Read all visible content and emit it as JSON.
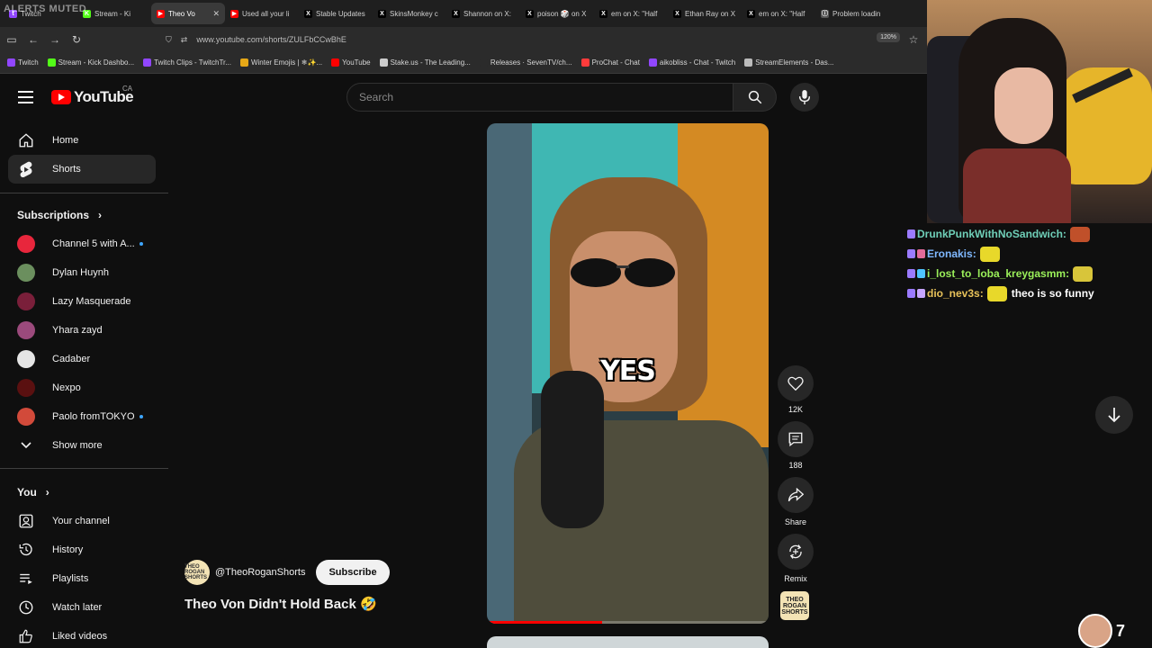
{
  "overlay": {
    "muted_text": "ALERTS MUTED"
  },
  "tabs": [
    {
      "label": "Twitch",
      "color": "#9146ff",
      "glyph": "t"
    },
    {
      "label": "Stream - Ki",
      "color": "#53fc18",
      "glyph": "K"
    },
    {
      "label": "Theo Vo",
      "color": "#ff0000",
      "glyph": "▶"
    },
    {
      "label": "Used all your li",
      "color": "#ff0000",
      "glyph": "▶"
    },
    {
      "label": "Stable Updates",
      "color": "#000000",
      "glyph": "X"
    },
    {
      "label": "SkinsMonkey c",
      "color": "#000000",
      "glyph": "X"
    },
    {
      "label": "Shannon on X:",
      "color": "#000000",
      "glyph": "X"
    },
    {
      "label": "poison 🎲 on X",
      "color": "#000000",
      "glyph": "X"
    },
    {
      "label": "em on X: \"Half",
      "color": "#000000",
      "glyph": "X"
    },
    {
      "label": "Ethan Ray on X",
      "color": "#000000",
      "glyph": "X"
    },
    {
      "label": "em on X: \"Half",
      "color": "#000000",
      "glyph": "X"
    },
    {
      "label": "Problem loadin",
      "color": "#555555",
      "glyph": "ⓘ"
    }
  ],
  "address": {
    "url": "www.youtube.com/shorts/ZULFbCCwBhE",
    "zoom": "120%"
  },
  "bookmarks": [
    {
      "label": "Twitch",
      "color": "#9146ff"
    },
    {
      "label": "Stream - Kick Dashbo...",
      "color": "#53fc18"
    },
    {
      "label": "Twitch Clips - TwitchTr...",
      "color": "#9146ff"
    },
    {
      "label": "Winter Emojis | ❄✨...",
      "color": "#e6a817"
    },
    {
      "label": "YouTube",
      "color": "#ff0000"
    },
    {
      "label": "Stake.us - The Leading...",
      "color": "#cccccc"
    },
    {
      "label": "Releases · SevenTV/ch...",
      "color": "#2b2b2b"
    },
    {
      "label": "ProChat - Chat",
      "color": "#ff3b3b"
    },
    {
      "label": "aikobliss - Chat - Twitch",
      "color": "#9146ff"
    },
    {
      "label": "StreamElements - Das...",
      "color": "#bbbbbb"
    }
  ],
  "header": {
    "logo_text": "YouTube",
    "country": "CA",
    "search_placeholder": "Search"
  },
  "sidebar": {
    "home": "Home",
    "shorts": "Shorts",
    "subscriptions_heading": "Subscriptions",
    "subscriptions": [
      {
        "label": "Channel 5 with A...",
        "color": "#e8263c",
        "new": true
      },
      {
        "label": "Dylan Huynh",
        "color": "#6b8f5e",
        "new": false
      },
      {
        "label": "Lazy Masquerade",
        "color": "#7a1f3a",
        "new": false
      },
      {
        "label": "Yhara zayd",
        "color": "#9b4a7c",
        "new": false
      },
      {
        "label": "Cadaber",
        "color": "#e5e5e5",
        "new": false
      },
      {
        "label": "Nexpo",
        "color": "#5a1010",
        "new": false
      },
      {
        "label": "Paolo fromTOKYO",
        "color": "#d24a3a",
        "new": true
      }
    ],
    "show_more": "Show more",
    "you_heading": "You",
    "you_items": [
      "Your channel",
      "History",
      "Playlists",
      "Watch later",
      "Liked videos"
    ]
  },
  "short": {
    "caption": "YES",
    "progress": 0.41,
    "channel_handle": "@TheoRoganShorts",
    "subscribe": "Subscribe",
    "title": "Theo Von Didn't Hold Back 🤣",
    "likes": "12K",
    "comments": "188",
    "share": "Share",
    "remix": "Remix",
    "channel_thumb_text": "THEO ROGAN SHORTS"
  },
  "chat": [
    {
      "user": "DrunkPunkWithNoSandwich:",
      "color": "#6fcfb8",
      "msg": "",
      "emote": "#c0502a"
    },
    {
      "user": "Eronakis:",
      "color": "#7fb8ff",
      "msg": "",
      "emote": "#e8d82a"
    },
    {
      "user": "i_lost_to_loba_kreygasmm:",
      "color": "#9bf05a",
      "msg": "",
      "emote": "#d8c53a"
    },
    {
      "user": "dio_nev3s:",
      "color": "#e8c25a",
      "msg": "theo is so funny",
      "emote": "#e8d82a"
    }
  ],
  "viewer_count": "7"
}
